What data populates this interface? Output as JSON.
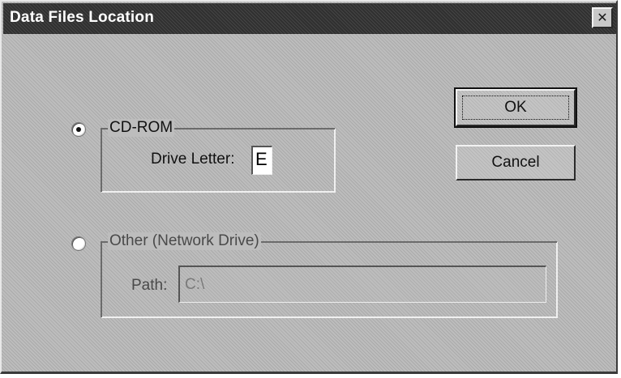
{
  "window": {
    "title": "Data Files Location",
    "close_glyph": "✕"
  },
  "buttons": {
    "ok_label": "OK",
    "cancel_label": "Cancel"
  },
  "cdrom": {
    "legend": "CD-ROM",
    "selected": true,
    "drive_label": "Drive Letter:",
    "drive_value": "E"
  },
  "other": {
    "legend": "Other (Network Drive)",
    "selected": false,
    "enabled": false,
    "path_label": "Path:",
    "path_value": "C:\\"
  },
  "icons": {
    "close": "close-icon",
    "radio_selected": "radio-selected-icon",
    "radio_unselected": "radio-unselected-icon"
  }
}
